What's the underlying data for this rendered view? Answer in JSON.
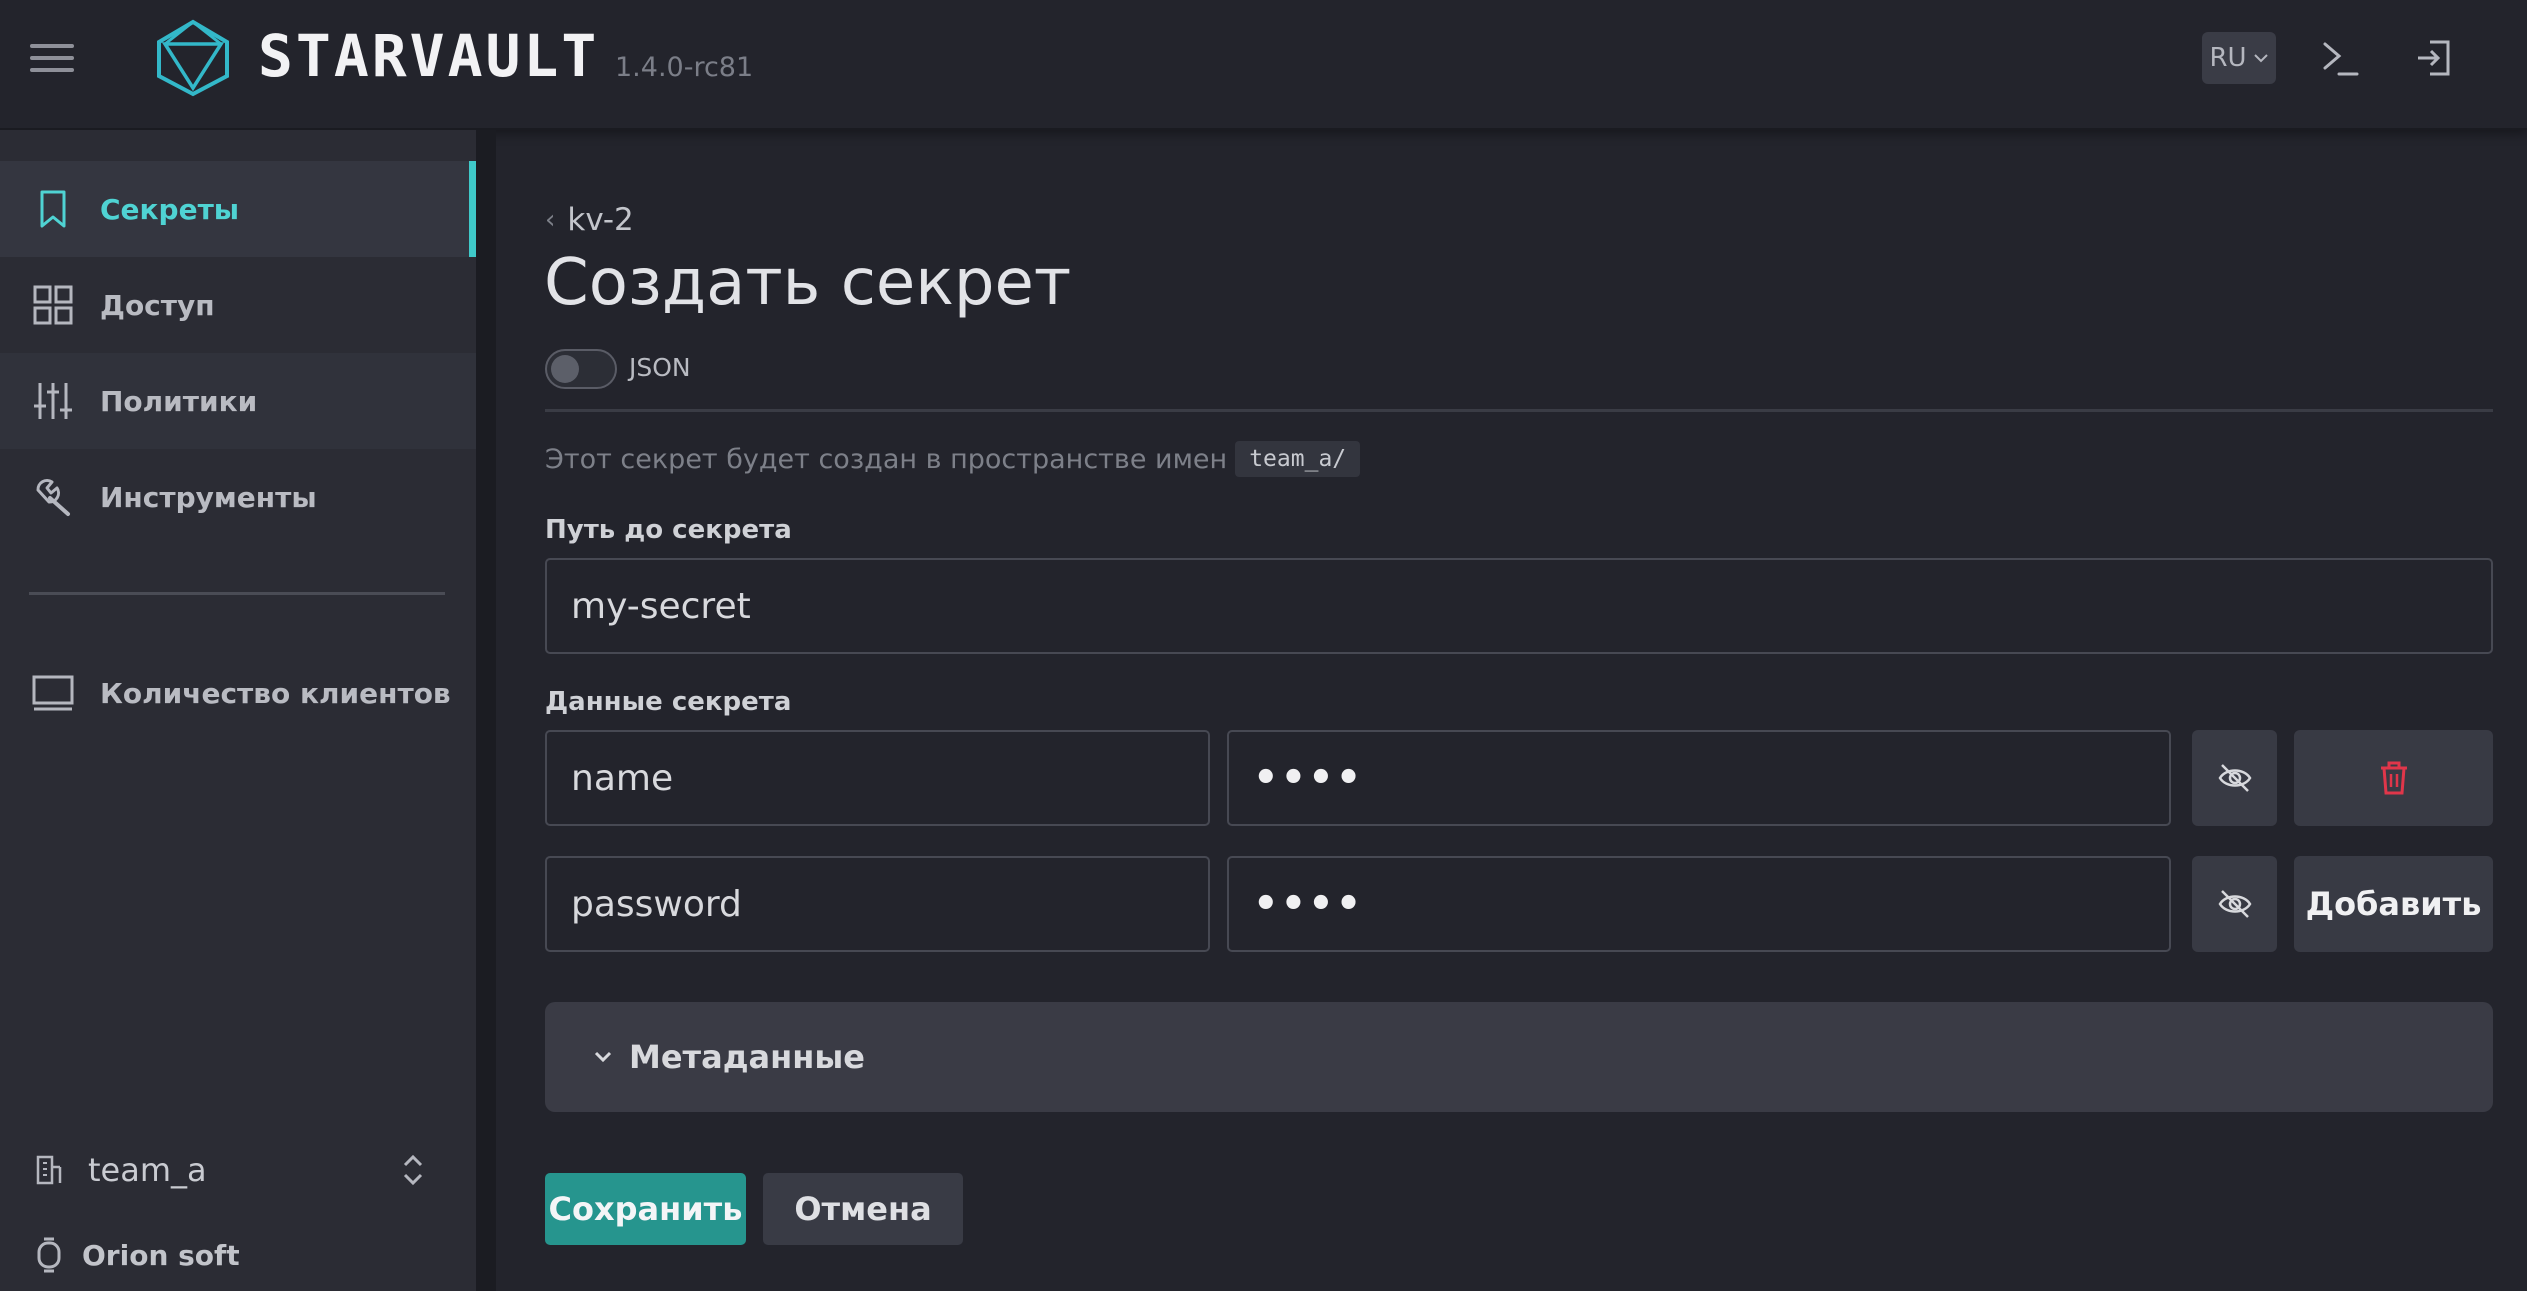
{
  "header": {
    "app_name": "STARVAULT",
    "version": "1.4.0-rc81",
    "language": "RU",
    "icons": [
      "menu-icon",
      "starvault-logo-icon",
      "terminal-icon",
      "logout-icon"
    ]
  },
  "sidebar": {
    "items": [
      {
        "label": "Секреты",
        "icon": "bookmark-icon",
        "active": true
      },
      {
        "label": "Доступ",
        "icon": "grid-icon"
      },
      {
        "label": "Политики",
        "icon": "sliders-icon"
      },
      {
        "label": "Инструменты",
        "icon": "tools-icon"
      },
      {
        "label": "Количество клиентов",
        "icon": "monitor-icon"
      }
    ],
    "namespace": "team_a",
    "vendor": "Orion soft"
  },
  "main": {
    "breadcrumb": "kv-2",
    "title": "Создать секрет",
    "json_toggle_label": "JSON",
    "json_toggle_on": false,
    "namespace_note": "Этот секрет будет создан в пространстве имен",
    "namespace_code": "team_a/",
    "path_label": "Путь до секрета",
    "path_value": "my-secret",
    "data_label": "Данные секрета",
    "rows": [
      {
        "key": "name",
        "value": "••••"
      },
      {
        "key": "password",
        "value": "••••"
      }
    ],
    "add_label": "Добавить",
    "metadata_label": "Метаданные",
    "save_label": "Сохранить",
    "cancel_label": "Отмена"
  },
  "colors": {
    "accent": "#3fc9c9",
    "primary_button": "#26958e",
    "danger": "#e0364a",
    "background": "#23242c",
    "sidebar": "#2b2c34"
  }
}
